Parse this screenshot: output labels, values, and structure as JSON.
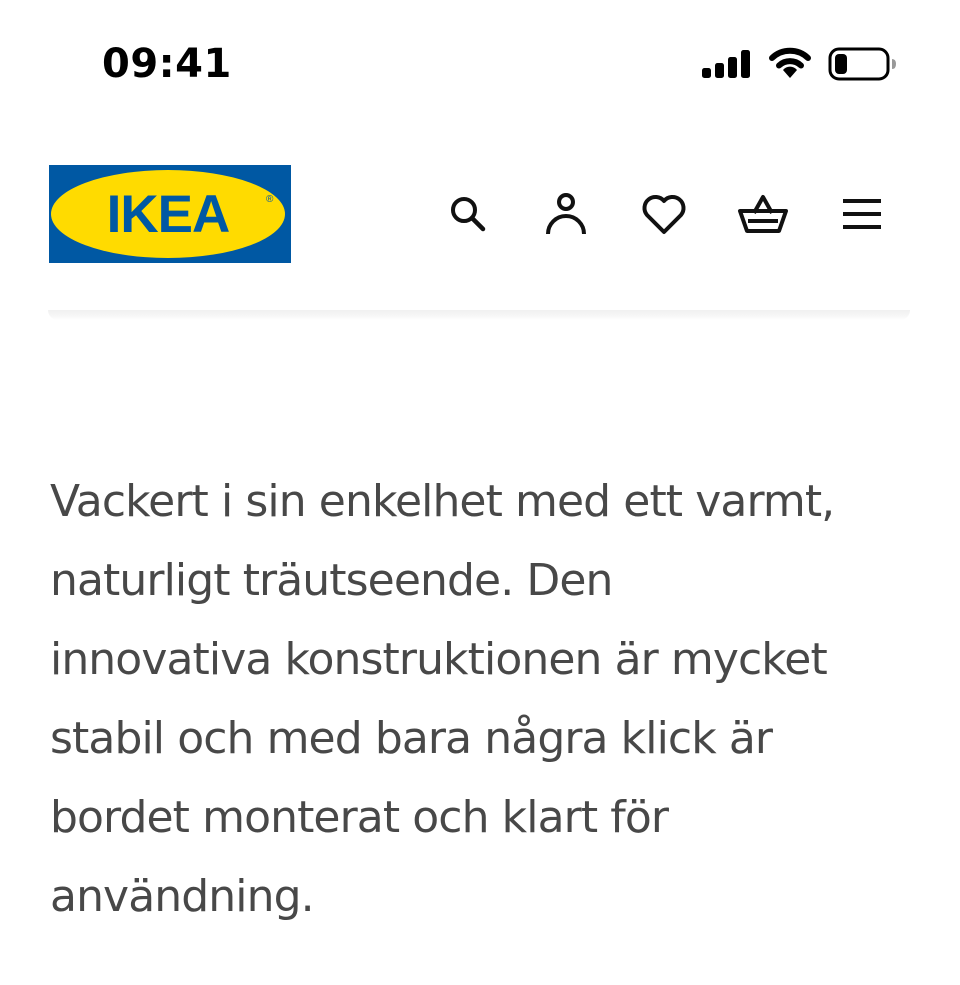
{
  "status_bar": {
    "time": "09:41",
    "icons": [
      "cellular-signal-icon",
      "wifi-icon",
      "battery-icon"
    ],
    "battery_level": 0.25
  },
  "header": {
    "logo": {
      "text": "IKEA",
      "colors": {
        "background": "#0058a3",
        "oval": "#ffdb00",
        "text": "#0058a3"
      }
    },
    "actions": [
      {
        "icon": "search-icon"
      },
      {
        "icon": "account-icon"
      },
      {
        "icon": "heart-icon"
      },
      {
        "icon": "shopping-basket-icon"
      },
      {
        "icon": "hamburger-menu-icon"
      }
    ]
  },
  "product": {
    "description_lines": [
      "Vackert i sin enkelhet med ett varmt,",
      "naturligt träutseende. Den",
      "innovativa konstruktionen är mycket",
      "stabil och med bara några klick är",
      "bordet monterat och klart för",
      "användning."
    ]
  },
  "colors": {
    "text_secondary": "#484848",
    "icon": "#111111"
  }
}
